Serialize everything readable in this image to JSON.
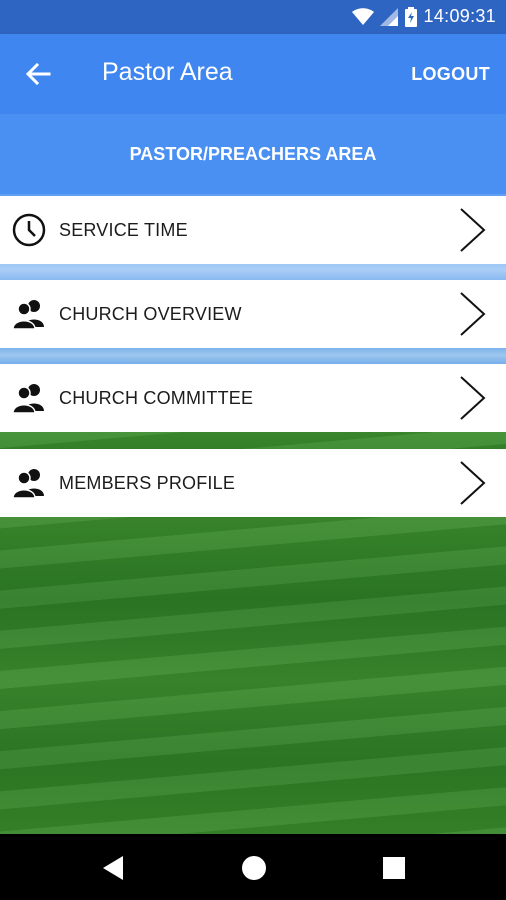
{
  "status_bar": {
    "time": "14:09:31",
    "icons": [
      "wifi-icon",
      "signal-icon",
      "battery-charging-icon"
    ]
  },
  "app_bar": {
    "title": "Pastor Area",
    "logout_label": "LOGOUT",
    "back_icon": "arrow-back-icon"
  },
  "section": {
    "title": "PASTOR/PREACHERS AREA"
  },
  "menu": {
    "items": [
      {
        "label": "SERVICE TIME",
        "icon": "clock-icon"
      },
      {
        "label": "CHURCH OVERVIEW",
        "icon": "people-icon"
      },
      {
        "label": "CHURCH COMMITTEE",
        "icon": "people-icon"
      },
      {
        "label": "MEMBERS PROFILE",
        "icon": "people-icon"
      }
    ]
  },
  "nav_bar": {
    "buttons": [
      "back-triangle-icon",
      "home-circle-icon",
      "recents-square-icon"
    ]
  },
  "colors": {
    "primary": "#3f86f0",
    "status_bar": "#2f65c2",
    "section_header": "#4a8ff2",
    "menu_background": "#ffffff",
    "text_dark": "#1c1c1c"
  }
}
